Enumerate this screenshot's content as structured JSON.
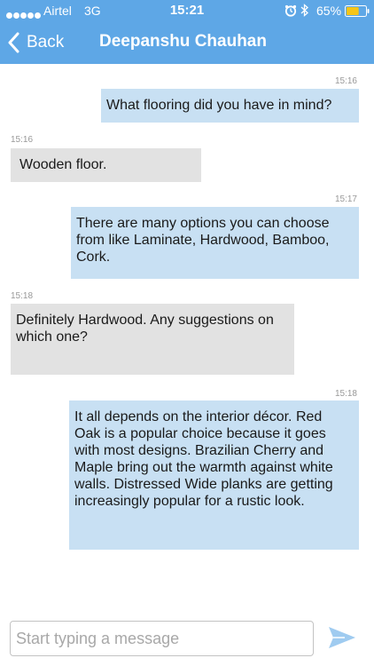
{
  "status_bar": {
    "carrier": "Airtel",
    "network": "3G",
    "time": "15:21",
    "battery": "65%",
    "battery_level": 0.65,
    "icons": [
      "signal-dots",
      "alarm-icon",
      "bluetooth-icon",
      "battery-icon"
    ]
  },
  "nav": {
    "back_label": "Back",
    "title": "Deepanshu Chauhan"
  },
  "messages": [
    {
      "direction": "out",
      "time": "15:16",
      "lines": [
        "What flooring did you have in mind?"
      ]
    },
    {
      "direction": "in",
      "time": "15:16",
      "lines": [
        "Wooden floor."
      ]
    },
    {
      "direction": "out",
      "time": "15:17",
      "lines": [
        "There are many options you can choose",
        "from like Laminate, Hardwood, Bamboo,",
        "Cork."
      ]
    },
    {
      "direction": "in",
      "time": "15:18",
      "lines": [
        "Definitely Hardwood. Any suggestions on",
        "which one?"
      ]
    },
    {
      "direction": "out",
      "time": "15:18",
      "lines": [
        "It all depends on the interior décor. Red",
        "Oak is a popular choice because it goes",
        "with most designs. Brazilian Cherry and",
        "Maple bring out the warmth against white",
        "walls. Distressed Wide planks are getting",
        "increasingly popular for a rustic look."
      ]
    }
  ],
  "composer": {
    "placeholder": "Start typing a message",
    "value": ""
  },
  "colors": {
    "header": "#5ea7e6",
    "outgoing_bubble": "#c8e0f3",
    "incoming_bubble": "#e2e2e2",
    "send_icon": "#9fcbf0"
  }
}
